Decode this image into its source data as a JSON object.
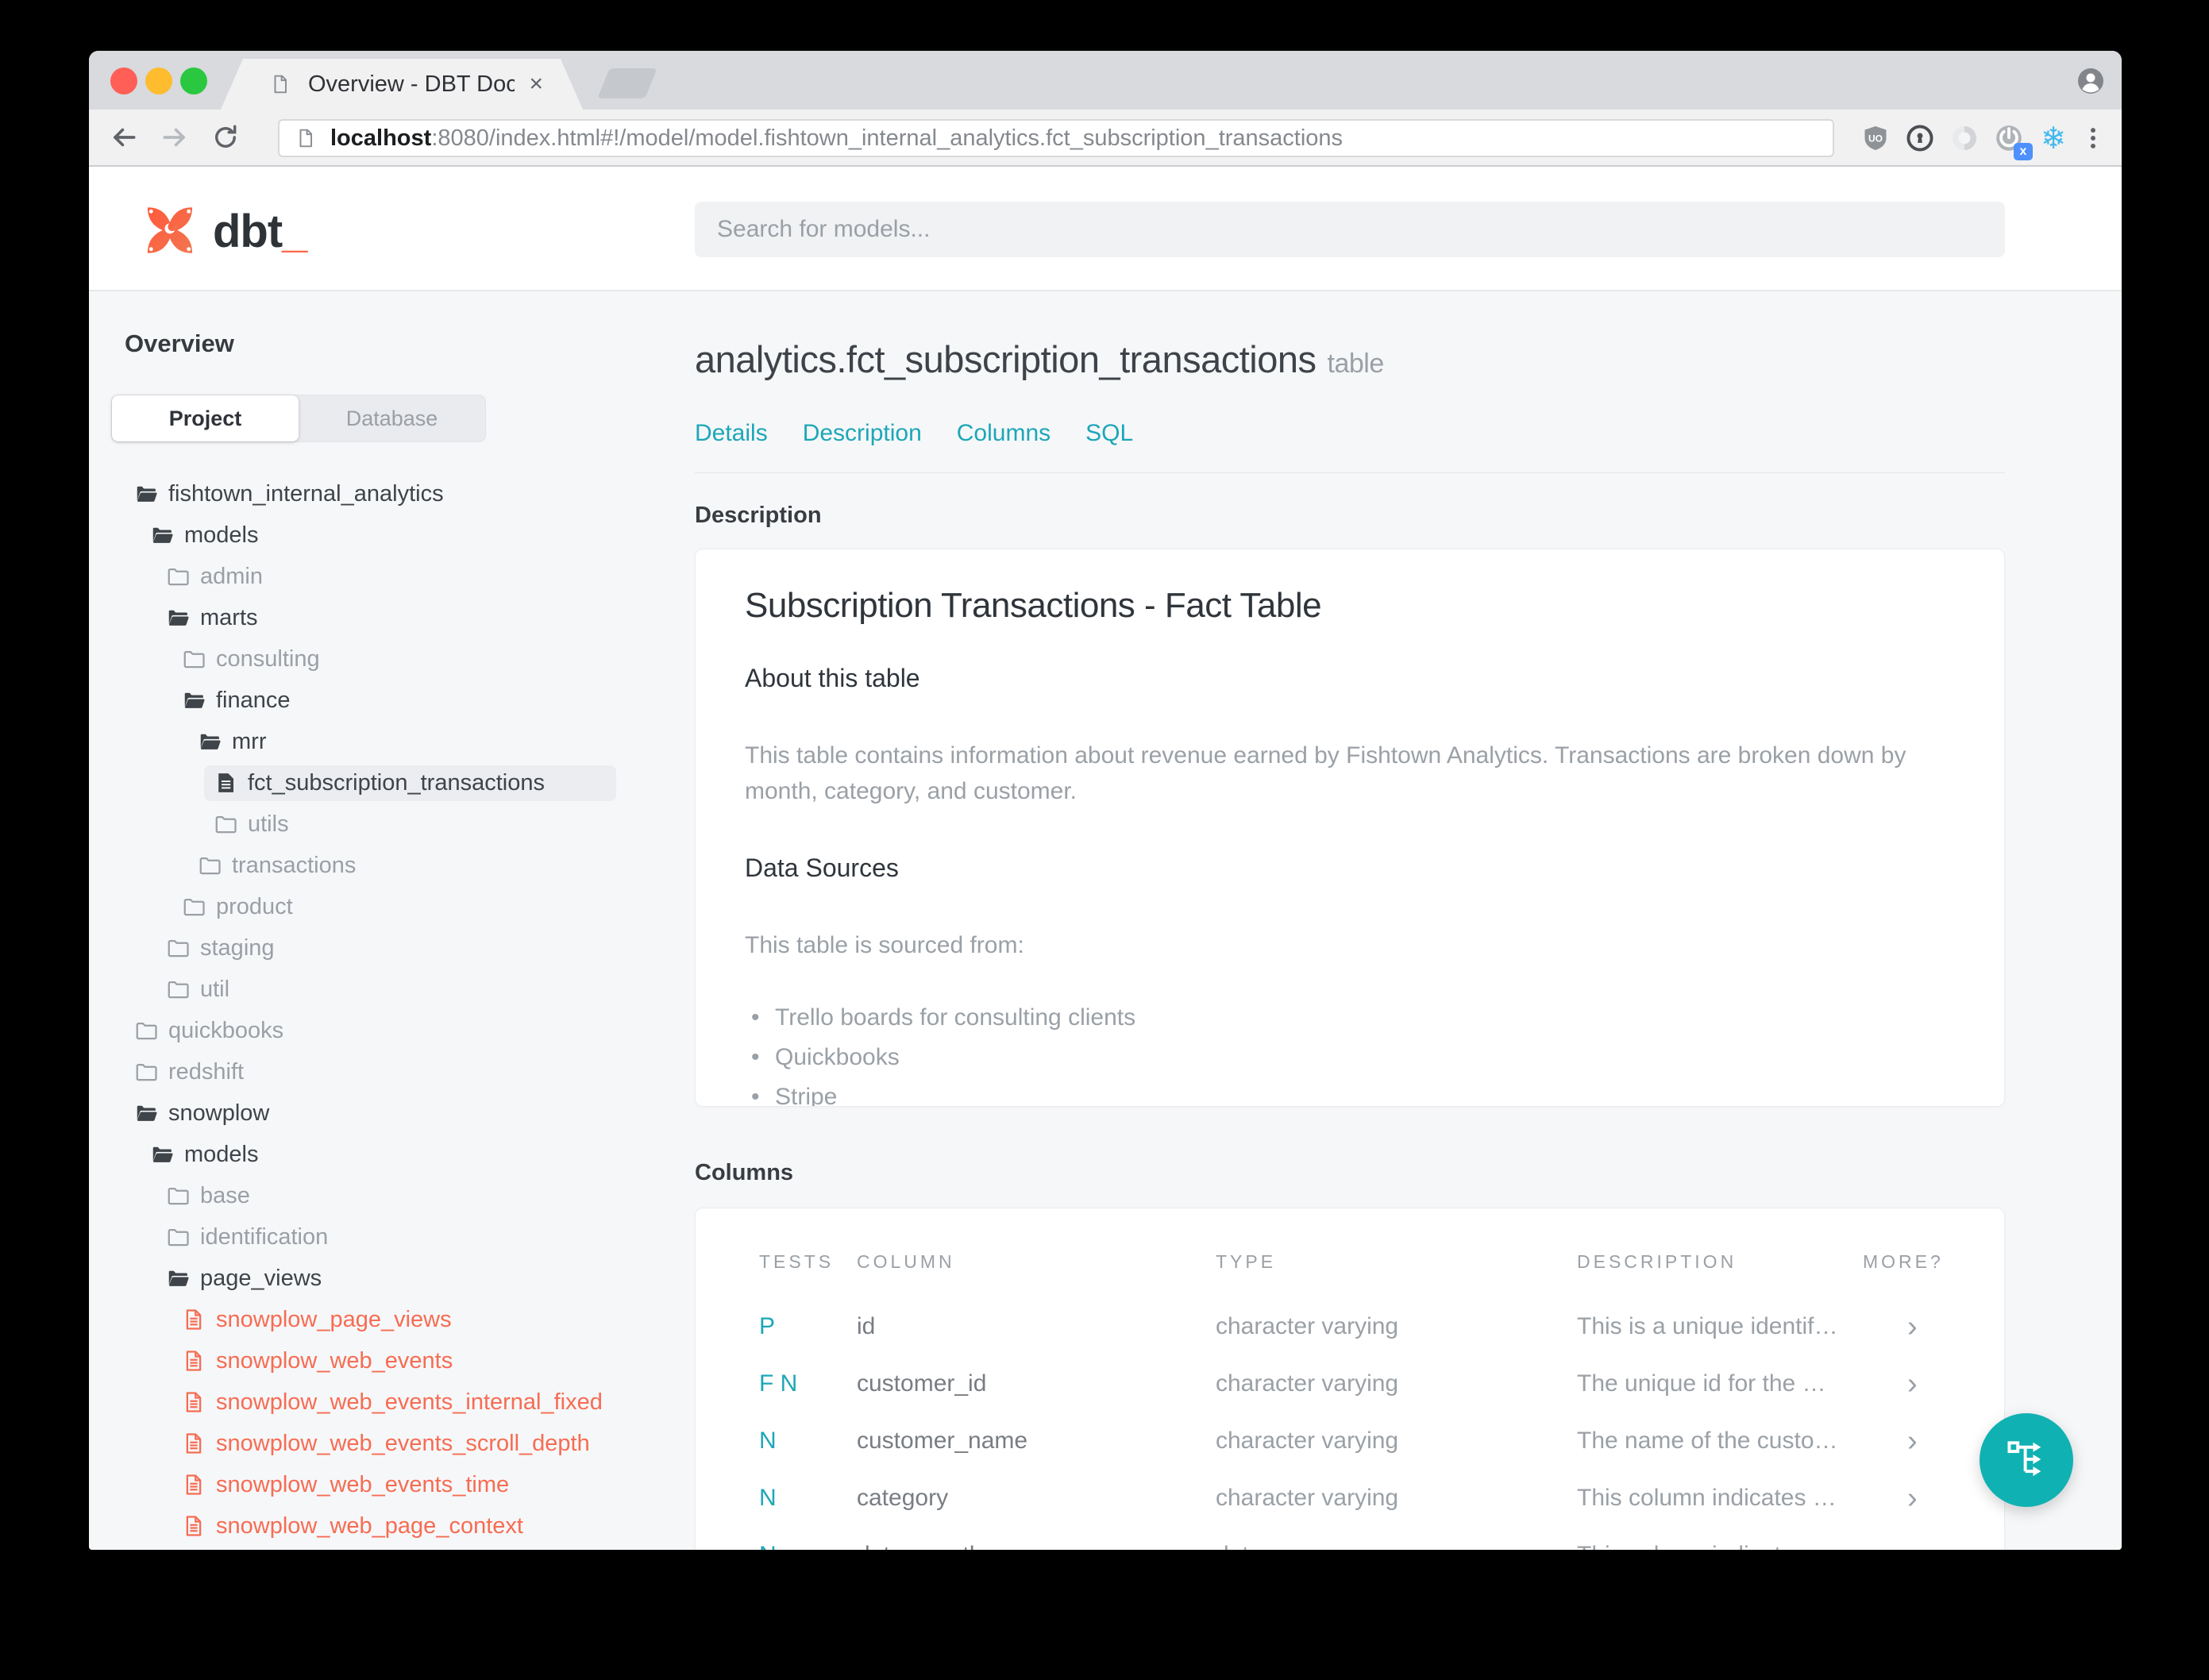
{
  "browser": {
    "tab_title": "Overview - DBT Docs",
    "close_label": "×",
    "url_host": "localhost",
    "url_rest": ":8080/index.html#!/model/model.fishtown_internal_analytics.fct_subscription_transactions"
  },
  "header": {
    "logo_text": "dbt",
    "logo_underscore": "_",
    "search_placeholder": "Search for models..."
  },
  "sidebar": {
    "title": "Overview",
    "tabs": [
      {
        "label": "Project",
        "active": true
      },
      {
        "label": "Database",
        "active": false
      }
    ],
    "tree": [
      {
        "label": "fishtown_internal_analytics",
        "level": 0,
        "type": "folder-open"
      },
      {
        "label": "models",
        "level": 1,
        "type": "folder-open"
      },
      {
        "label": "admin",
        "level": 2,
        "type": "folder-closed"
      },
      {
        "label": "marts",
        "level": 2,
        "type": "folder-open"
      },
      {
        "label": "consulting",
        "level": 3,
        "type": "folder-closed"
      },
      {
        "label": "finance",
        "level": 3,
        "type": "folder-open"
      },
      {
        "label": "mrr",
        "level": 4,
        "type": "folder-open"
      },
      {
        "label": "fct_subscription_transactions",
        "level": 5,
        "type": "file",
        "selected": true
      },
      {
        "label": "utils",
        "level": 5,
        "type": "folder-closed"
      },
      {
        "label": "transactions",
        "level": 4,
        "type": "folder-closed"
      },
      {
        "label": "product",
        "level": 3,
        "type": "folder-closed"
      },
      {
        "label": "staging",
        "level": 2,
        "type": "folder-closed"
      },
      {
        "label": "util",
        "level": 2,
        "type": "folder-closed"
      },
      {
        "label": "quickbooks",
        "level": 0,
        "type": "folder-closed"
      },
      {
        "label": "redshift",
        "level": 0,
        "type": "folder-closed"
      },
      {
        "label": "snowplow",
        "level": 0,
        "type": "folder-open"
      },
      {
        "label": "models",
        "level": 1,
        "type": "folder-open"
      },
      {
        "label": "base",
        "level": 2,
        "type": "folder-closed"
      },
      {
        "label": "identification",
        "level": 2,
        "type": "folder-closed"
      },
      {
        "label": "page_views",
        "level": 2,
        "type": "folder-open"
      },
      {
        "label": "snowplow_page_views",
        "level": 3,
        "type": "file-red"
      },
      {
        "label": "snowplow_web_events",
        "level": 3,
        "type": "file-red"
      },
      {
        "label": "snowplow_web_events_internal_fixed",
        "level": 3,
        "type": "file-red"
      },
      {
        "label": "snowplow_web_events_scroll_depth",
        "level": 3,
        "type": "file-red"
      },
      {
        "label": "snowplow_web_events_time",
        "level": 3,
        "type": "file-red"
      },
      {
        "label": "snowplow_web_page_context",
        "level": 3,
        "type": "file-red"
      }
    ]
  },
  "main": {
    "title": "analytics.fct_subscription_transactions",
    "title_suffix": "table",
    "nav": [
      "Details",
      "Description",
      "Columns",
      "SQL"
    ],
    "description_section": {
      "label": "Description",
      "card_title": "Subscription Transactions - Fact Table",
      "about_heading": "About this table",
      "about_text": "This table contains information about revenue earned by Fishtown Analytics. Transactions are broken down by month, category, and customer.",
      "sources_heading": "Data Sources",
      "sources_intro": "This table is sourced from:",
      "sources": [
        "Trello boards for consulting clients",
        "Quickbooks",
        "Stripe"
      ]
    },
    "columns_section": {
      "label": "Columns",
      "headers": [
        "TESTS",
        "COLUMN",
        "TYPE",
        "DESCRIPTION",
        "MORE?"
      ],
      "rows": [
        {
          "tests": "P",
          "column": "id",
          "type": "character varying",
          "description": "This is a unique identif…"
        },
        {
          "tests": "F N",
          "column": "customer_id",
          "type": "character varying",
          "description": "The unique id for the …"
        },
        {
          "tests": "N",
          "column": "customer_name",
          "type": "character varying",
          "description": "The name of the custo…"
        },
        {
          "tests": "N",
          "column": "category",
          "type": "character varying",
          "description": "This column indicates …"
        },
        {
          "tests": "N",
          "column": "date_month",
          "type": "date",
          "description": "This column indicates …"
        }
      ]
    }
  },
  "icons": {
    "fab": "lineage-graph",
    "row_expand": "chevron-right"
  },
  "colors": {
    "accent_teal": "#1ca7b7",
    "fab_teal": "#10b1b3",
    "brand_orange": "#ff694b",
    "file_red": "#f76c52",
    "snowflake_blue": "#41b9ee",
    "badge_blue": "#4d90fe",
    "content_bg": "#f6f7f9"
  }
}
